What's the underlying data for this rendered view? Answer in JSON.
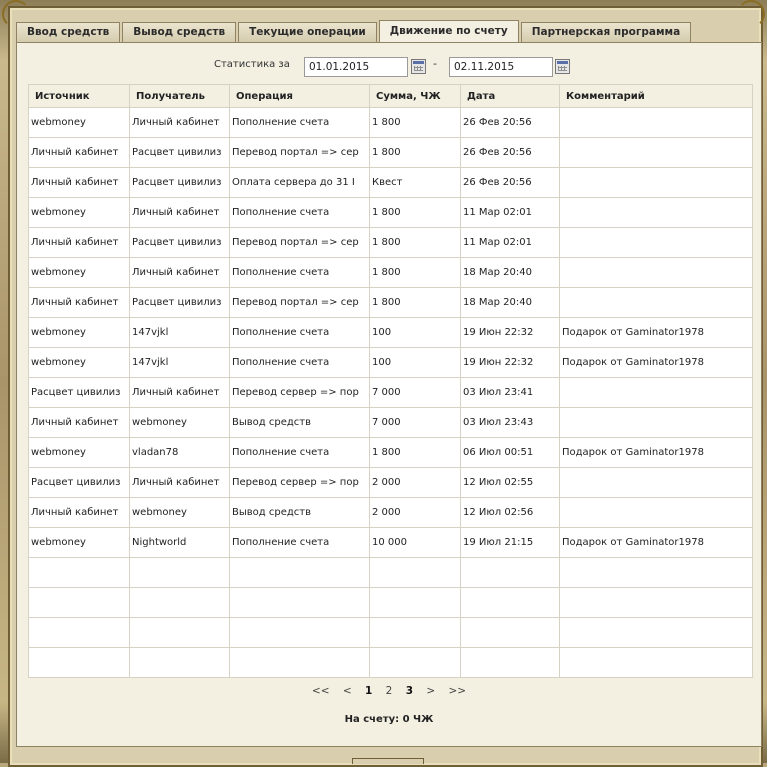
{
  "tabs": [
    {
      "label": "Ввод средств",
      "active": false
    },
    {
      "label": "Вывод средств",
      "active": false
    },
    {
      "label": "Текущие операции",
      "active": false
    },
    {
      "label": "Движение по счету",
      "active": true
    },
    {
      "label": "Партнерская программа",
      "active": false
    }
  ],
  "filter": {
    "label": "Статистика за",
    "date_from": "01.01.2015",
    "separator": "-",
    "date_to": "02.11.2015"
  },
  "table": {
    "columns": [
      "Источник",
      "Получатель",
      "Операция",
      "Сумма, ЧЖ",
      "Дата",
      "Комментарий"
    ],
    "rows": [
      [
        "webmoney",
        "Личный кабинет",
        "Пополнение счета",
        "1 800",
        "26 Фев 20:56",
        ""
      ],
      [
        "Личный кабинет",
        "Расцвет цивилиз",
        "Перевод портал => сер",
        "1 800",
        "26 Фев 20:56",
        ""
      ],
      [
        "Личный кабинет",
        "Расцвет цивилиз",
        "Оплата сервера до 31 I",
        "Квест",
        "26 Фев 20:56",
        ""
      ],
      [
        "webmoney",
        "Личный кабинет",
        "Пополнение счета",
        "1 800",
        "11 Мар 02:01",
        ""
      ],
      [
        "Личный кабинет",
        "Расцвет цивилиз",
        "Перевод портал => сер",
        "1 800",
        "11 Мар 02:01",
        ""
      ],
      [
        "webmoney",
        "Личный кабинет",
        "Пополнение счета",
        "1 800",
        "18 Мар 20:40",
        ""
      ],
      [
        "Личный кабинет",
        "Расцвет цивилиз",
        "Перевод портал => сер",
        "1 800",
        "18 Мар 20:40",
        ""
      ],
      [
        "webmoney",
        "147vjkl",
        "Пополнение счета",
        "100",
        "19 Июн 22:32",
        "Подарок от Gaminator1978"
      ],
      [
        "webmoney",
        "147vjkl",
        "Пополнение счета",
        "100",
        "19 Июн 22:32",
        "Подарок от Gaminator1978"
      ],
      [
        "Расцвет цивилиз",
        "Личный кабинет",
        "Перевод сервер => пор",
        "7 000",
        "03 Июл 23:41",
        ""
      ],
      [
        "Личный кабинет",
        "webmoney",
        "Вывод средств",
        "7 000",
        "03 Июл 23:43",
        ""
      ],
      [
        "webmoney",
        "vladan78",
        "Пополнение счета",
        "1 800",
        "06 Июл 00:51",
        "Подарок от Gaminator1978"
      ],
      [
        "Расцвет цивилиз",
        "Личный кабинет",
        "Перевод сервер => пор",
        "2 000",
        "12 Июл 02:55",
        ""
      ],
      [
        "Личный кабинет",
        "webmoney",
        "Вывод средств",
        "2 000",
        "12 Июл 02:56",
        ""
      ],
      [
        "webmoney",
        "Nightworld",
        "Пополнение счета",
        "10 000",
        "19 Июл 21:15",
        "Подарок от Gaminator1978"
      ],
      [
        "",
        "",
        "",
        "",
        "",
        ""
      ],
      [
        "",
        "",
        "",
        "",
        "",
        ""
      ],
      [
        "",
        "",
        "",
        "",
        "",
        ""
      ],
      [
        "",
        "",
        "",
        "",
        "",
        ""
      ]
    ]
  },
  "pager": {
    "first": "<<",
    "prev": "<",
    "pages": [
      "1",
      "2",
      "3"
    ],
    "current": "1",
    "next": ">",
    "last": ">>"
  },
  "balance": "На счету: 0 ЧЖ",
  "colors": {
    "frame": "#b9a77c",
    "panel": "#f3efe1",
    "tab": "#e2dac0"
  }
}
